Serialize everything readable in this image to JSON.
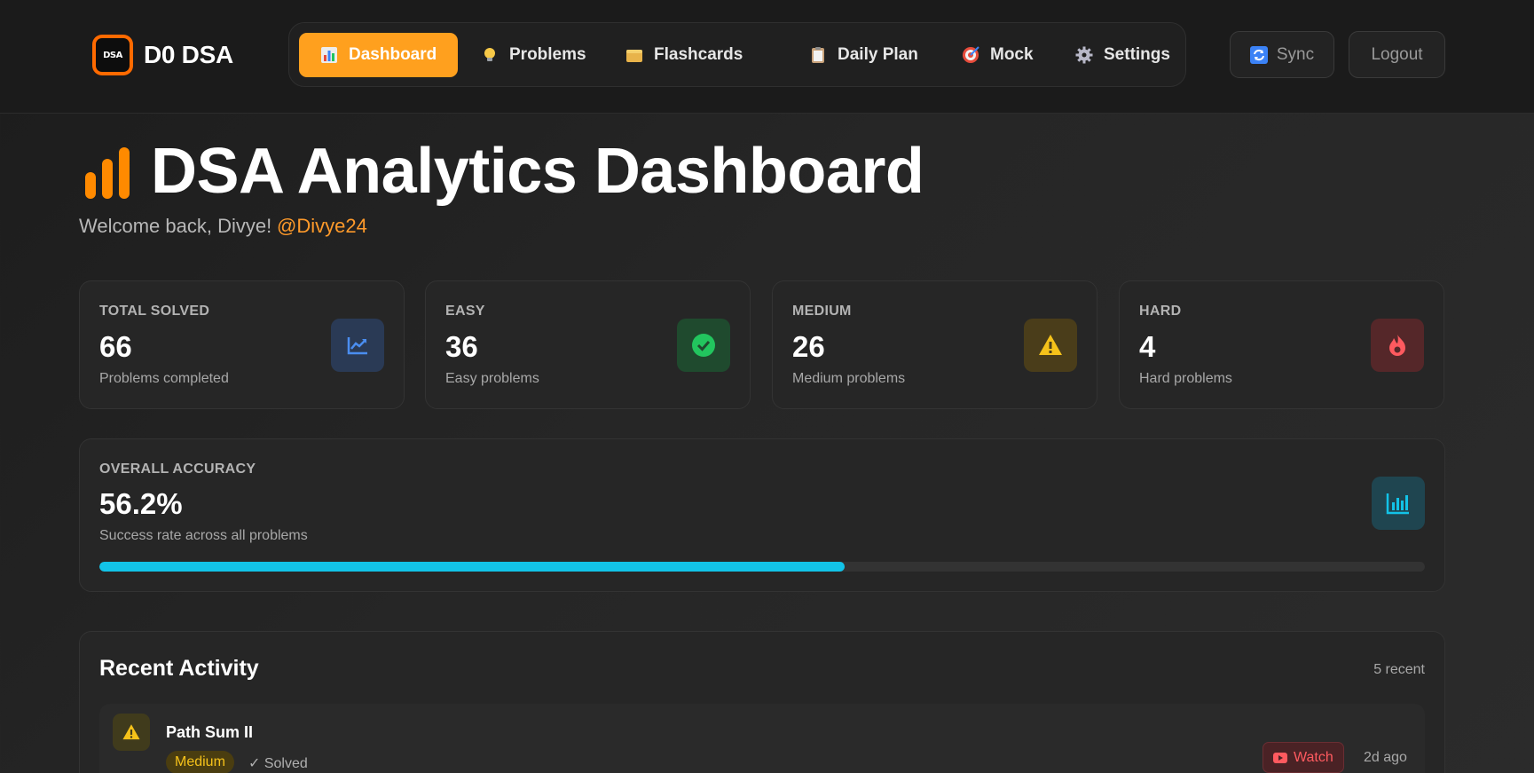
{
  "brand": {
    "logo_text": "DSA",
    "name": "D0 DSA"
  },
  "nav": {
    "items": [
      {
        "label": "Dashboard",
        "icon": "bar-chart-icon",
        "active": true
      },
      {
        "label": "Problems",
        "icon": "lightbulb-icon",
        "active": false
      },
      {
        "label": "Flashcards",
        "icon": "card-box-icon",
        "active": false
      },
      {
        "label": "Daily Plan",
        "icon": "clipboard-icon",
        "active": false
      },
      {
        "label": "Mock",
        "icon": "target-icon",
        "active": false
      },
      {
        "label": "Settings",
        "icon": "gear-icon",
        "active": false
      }
    ]
  },
  "actions": {
    "sync_label": "Sync",
    "logout_label": "Logout"
  },
  "page": {
    "title": "DSA Analytics Dashboard",
    "welcome": "Welcome back, Divye!",
    "username": "@Divye24"
  },
  "stats": [
    {
      "label": "TOTAL SOLVED",
      "value": "66",
      "sub": "Problems completed",
      "icon": "trending-up-icon",
      "color": "#4a8df0"
    },
    {
      "label": "EASY",
      "value": "36",
      "sub": "Easy problems",
      "icon": "check-circle-icon",
      "color": "#22c55e"
    },
    {
      "label": "MEDIUM",
      "value": "26",
      "sub": "Medium problems",
      "icon": "warning-icon",
      "color": "#f5c21a"
    },
    {
      "label": "HARD",
      "value": "4",
      "sub": "Hard problems",
      "icon": "flame-icon",
      "color": "#ff5a5f"
    }
  ],
  "accuracy": {
    "label": "OVERALL ACCURACY",
    "value": "56.2%",
    "sub": "Success rate across all problems",
    "progress": 0.562,
    "icon": "bar-chart-icon",
    "color": "#12c3e8"
  },
  "recent": {
    "title": "Recent Activity",
    "count_label": "5 recent",
    "items": [
      {
        "title": "Path Sum II",
        "difficulty": "Medium",
        "status": "✓ Solved",
        "watch_label": "Watch",
        "time": "2d ago",
        "icon": "warning-icon"
      }
    ]
  }
}
